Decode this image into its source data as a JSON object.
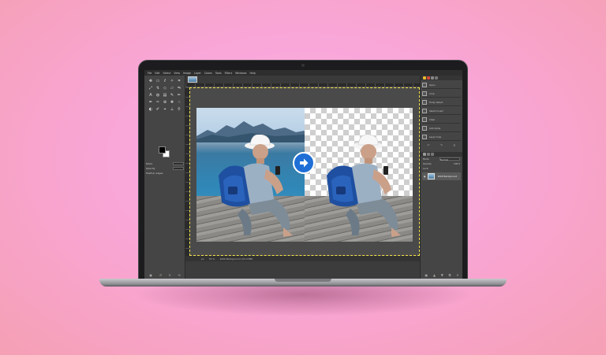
{
  "app": {
    "menu": [
      "File",
      "Edit",
      "Select",
      "View",
      "Image",
      "Layer",
      "Colors",
      "Tools",
      "Filters",
      "Windows",
      "Help"
    ]
  },
  "toolbox": {
    "tools": [
      "move-tool",
      "rect-select-tool",
      "lasso-tool",
      "fuzzy-select-tool",
      "crop-tool",
      "unified-transform-tool",
      "warp-tool",
      "cage-tool",
      "perspective-tool",
      "flip-tool",
      "text-tool",
      "bucket-fill-tool",
      "gradient-tool",
      "paintbrush-tool",
      "pencil-tool",
      "airbrush-tool",
      "ink-tool",
      "clone-tool",
      "heal-tool",
      "smudge-tool",
      "dodge-tool",
      "paths-tool",
      "color-picker-tool",
      "measure-tool",
      "zoom-tool"
    ],
    "foreground_color": "#000000",
    "background_color": "#ffffff",
    "options": {
      "mode_label": "Mode",
      "opacity_label": "Opacity",
      "feather_label": "Feather edges"
    }
  },
  "statusbar": {
    "unit": "px",
    "zoom": "50 %",
    "info": "1000 Background (43.0 MB)"
  },
  "history": {
    "items": [
      "Open",
      "Crop",
      "Fuzzy Select",
      "Select Invert",
      "Clear",
      "Add Alpha",
      "Layer Crop"
    ]
  },
  "layers": {
    "mode_label": "Mode",
    "mode_value": "Normal",
    "opacity_label": "Opacity",
    "opacity_value": "100.0",
    "lock_label": "Lock:",
    "layer_name": "1000 Background"
  },
  "colors": {
    "accent": "#1f6fd6",
    "ui_background": "#3c3c3c",
    "selection_outline": "#f6e64a"
  }
}
